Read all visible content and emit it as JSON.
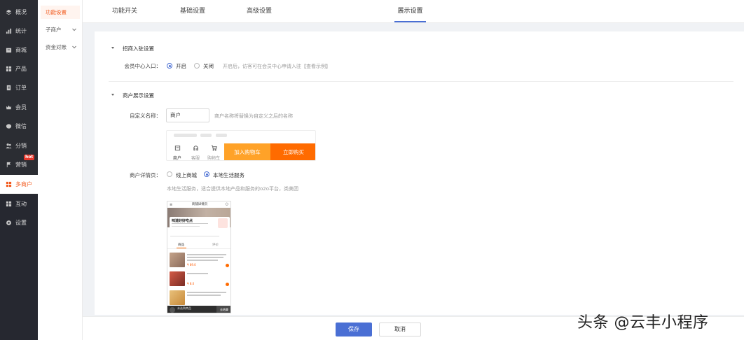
{
  "sidebar": {
    "items": [
      {
        "label": "概况",
        "icon": "layers-icon"
      },
      {
        "label": "统计",
        "icon": "chart-icon"
      },
      {
        "label": "商城",
        "icon": "shop-icon"
      },
      {
        "label": "产品",
        "icon": "grid-icon"
      },
      {
        "label": "订单",
        "icon": "order-icon"
      },
      {
        "label": "会员",
        "icon": "crown-icon"
      },
      {
        "label": "微信",
        "icon": "wechat-icon"
      },
      {
        "label": "分销",
        "icon": "users-icon"
      },
      {
        "label": "营销",
        "icon": "flag-icon"
      },
      {
        "label": "多商户",
        "icon": "merchant-icon"
      },
      {
        "label": "互动",
        "icon": "interact-icon"
      },
      {
        "label": "设置",
        "icon": "gear-icon"
      }
    ],
    "hot_badge": "hot",
    "active_color": "#f25a1d"
  },
  "submenu": {
    "items": [
      {
        "label": "功能设置"
      },
      {
        "label": "子商户"
      },
      {
        "label": "资金对账"
      }
    ]
  },
  "tabs": [
    "功能开关",
    "基础设置",
    "高级设置",
    "展示设置"
  ],
  "active_tab": "展示设置",
  "section1": {
    "title": "招商入驻设置",
    "field_label": "会员中心入口：",
    "opt_on": "开启",
    "opt_off": "关闭",
    "hint": "开启后，访客可在会员中心申请入驻【查看示例】"
  },
  "section2": {
    "title": "商户展示设置",
    "name_label": "自定义名称：",
    "name_value": "商户",
    "name_hint": "商户名称将替换为自定义之后的名称",
    "preview": {
      "icon1": "商户",
      "icon2": "客服",
      "icon3": "购物车",
      "cart_button": "加入购物车",
      "buy_button": "立即购买"
    },
    "detail_label": "商户详情页：",
    "opt_online": "线上商城",
    "opt_local": "本地生活服务",
    "detail_hint": "本地生活服务，适合提供本地产品和服务的o2o平台，类美团"
  },
  "phone": {
    "header": "商铺详情页",
    "shop_title": "味道好好吃点",
    "tab_goods": "商品",
    "tab_reviews": "评价",
    "prices": [
      "¥ 89.0",
      "¥ 8.0"
    ],
    "footer_text": "未选购商品",
    "footer_btn": "去结算"
  },
  "footer": {
    "save": "保存",
    "cancel": "取消"
  },
  "watermark": "头条 @云丰小程序",
  "colors": {
    "primary": "#4a6fd4",
    "orange": "#ff6b00",
    "amber": "#ffa228"
  }
}
